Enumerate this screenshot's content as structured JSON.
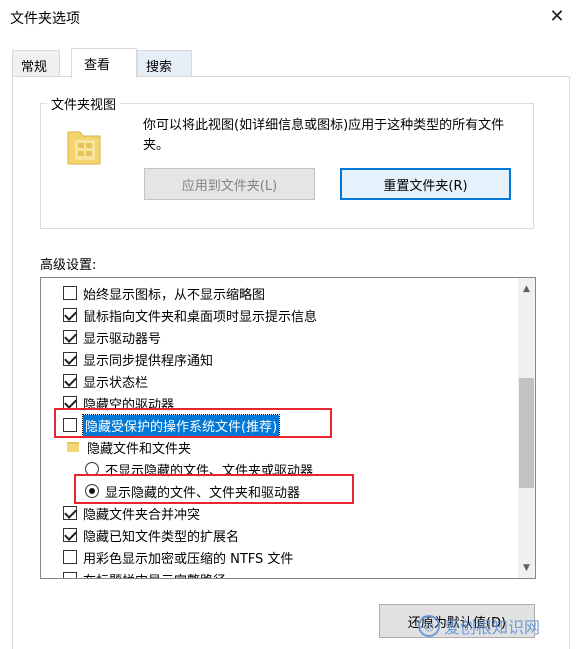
{
  "window": {
    "title": "文件夹选项"
  },
  "tabs": [
    {
      "label": "常规"
    },
    {
      "label": "查看"
    },
    {
      "label": "搜索"
    }
  ],
  "folder_views": {
    "title": "文件夹视图",
    "description": "你可以将此视图(如详细信息或图标)应用于这种类型的所有文件夹。",
    "apply_button": "应用到文件夹(L)",
    "reset_button": "重置文件夹(R)"
  },
  "advanced": {
    "label": "高级设置:",
    "items": [
      {
        "label": "始终显示图标，从不显示缩略图"
      },
      {
        "label": "鼠标指向文件夹和桌面项时显示提示信息"
      },
      {
        "label": "显示驱动器号"
      },
      {
        "label": "显示同步提供程序通知"
      },
      {
        "label": "显示状态栏"
      },
      {
        "label": "隐藏空的驱动器"
      },
      {
        "label": "隐藏受保护的操作系统文件(推荐)"
      },
      {
        "label": "隐藏文件和文件夹"
      },
      {
        "label": "不显示隐藏的文件、文件夹或驱动器"
      },
      {
        "label": "显示隐藏的文件、文件夹和驱动器"
      },
      {
        "label": "隐藏文件夹合并冲突"
      },
      {
        "label": "隐藏已知文件类型的扩展名"
      },
      {
        "label": "用彩色显示加密或压缩的 NTFS 文件"
      },
      {
        "label": "在标题栏中显示完整路径"
      }
    ]
  },
  "footer": {
    "restore_button": "还原为默认值(D)"
  },
  "watermark": {
    "text": "爱创根知识网"
  }
}
